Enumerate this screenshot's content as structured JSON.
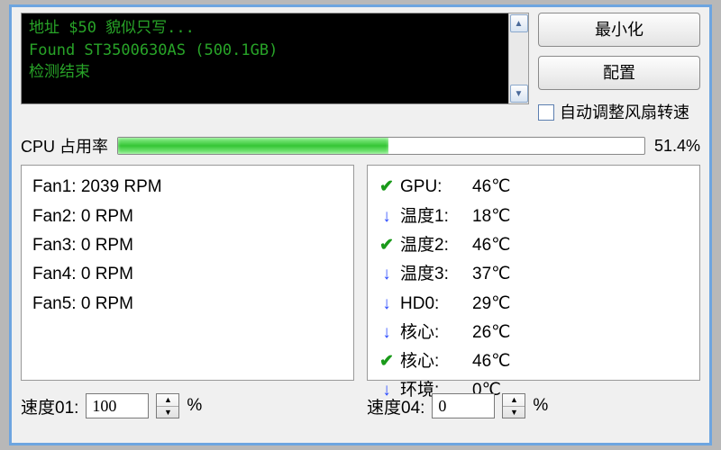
{
  "console": {
    "line1": "地址 $50 貌似只写...",
    "line2": "Found ST3500630AS (500.1GB)",
    "line3": "检测结束"
  },
  "buttons": {
    "minimize": "最小化",
    "config": "配置"
  },
  "autoFan": {
    "label": "自动调整风扇转速"
  },
  "cpu": {
    "label": "CPU 占用率",
    "percent_text": "51.4%",
    "percent_value": 51.4
  },
  "fans": [
    {
      "label": "Fan1:",
      "value": "2039 RPM"
    },
    {
      "label": "Fan2:",
      "value": "0 RPM"
    },
    {
      "label": "Fan3:",
      "value": "0 RPM"
    },
    {
      "label": "Fan4:",
      "value": "0 RPM"
    },
    {
      "label": "Fan5:",
      "value": "0 RPM"
    }
  ],
  "sensors": [
    {
      "icon": "ok",
      "label": "GPU:",
      "value": "46℃"
    },
    {
      "icon": "down",
      "label": "温度1:",
      "value": "18℃"
    },
    {
      "icon": "ok",
      "label": "温度2:",
      "value": "46℃"
    },
    {
      "icon": "down",
      "label": "温度3:",
      "value": "37℃"
    },
    {
      "icon": "down",
      "label": "HD0:",
      "value": "29℃"
    },
    {
      "icon": "down",
      "label": "核心:",
      "value": "26℃"
    },
    {
      "icon": "ok",
      "label": "核心:",
      "value": "46℃"
    },
    {
      "icon": "down",
      "label": "环境:",
      "value": "0℃"
    }
  ],
  "speeds": {
    "s1": {
      "label": "速度01:",
      "value": "100",
      "unit": "%"
    },
    "s4": {
      "label": "速度04:",
      "value": "0",
      "unit": "%"
    }
  }
}
